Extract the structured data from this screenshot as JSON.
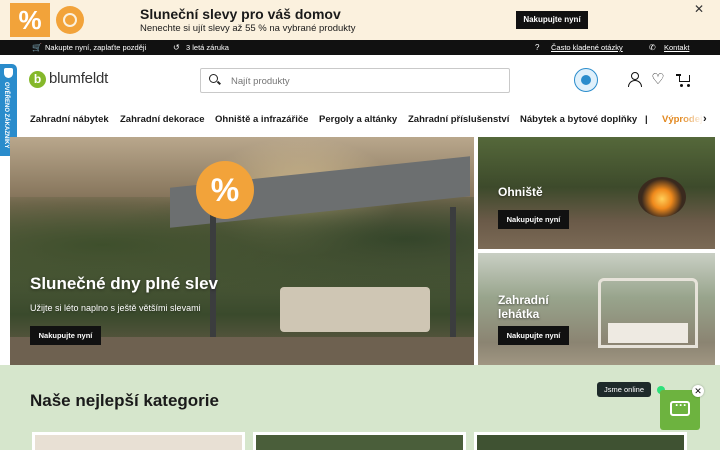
{
  "promo": {
    "percent_glyph": "%",
    "title": "Sluneční slevy pro váš domov",
    "subtitle": "Nenechte si ujít slevy až 55 % na vybrané produkty",
    "button": "Nakupujte nyní",
    "close": "✕"
  },
  "topbar": {
    "buy_now_pay_later": "Nakupte nyní, zaplaťte později",
    "warranty": "3 letá záruka",
    "faq": "Často kladené otázky",
    "contact": "Kontakt"
  },
  "side_tab": {
    "label": "OVĚŘENO ZÁKAZNÍKY"
  },
  "header": {
    "logo_mark": "b",
    "logo_text": "blumfeldt",
    "search_placeholder": "Najít produkty",
    "heart": "♡"
  },
  "nav": {
    "items": [
      "Zahradní nábytek",
      "Zahradní dekorace",
      "Ohniště a infrazářiče",
      "Pergoly a altánky",
      "Zahradní příslušenství",
      "Nábytek a bytové doplňky",
      "|",
      "Výprodej"
    ],
    "arrow": "›"
  },
  "hero": {
    "badge": "%",
    "title": "Slunečné dny plné slev",
    "subtitle": "Užijte si léto naplno s ještě většími slevami",
    "button": "Nakupujte nyní"
  },
  "tiles": [
    {
      "title": "Ohniště",
      "button": "Nakupujte nyní"
    },
    {
      "title": "Zahradní\nlehátka",
      "button": "Nakupujte nyní"
    }
  ],
  "categories": {
    "title": "Naše nejlepší kategorie"
  },
  "chat": {
    "status": "Jsme online",
    "close": "✕"
  },
  "colors": {
    "accent_orange": "#f2a33a",
    "brand_green": "#85b82b",
    "trust_blue": "#2a8ccc",
    "chat_green": "#6db33f",
    "section_bg": "#d6e6cc"
  }
}
